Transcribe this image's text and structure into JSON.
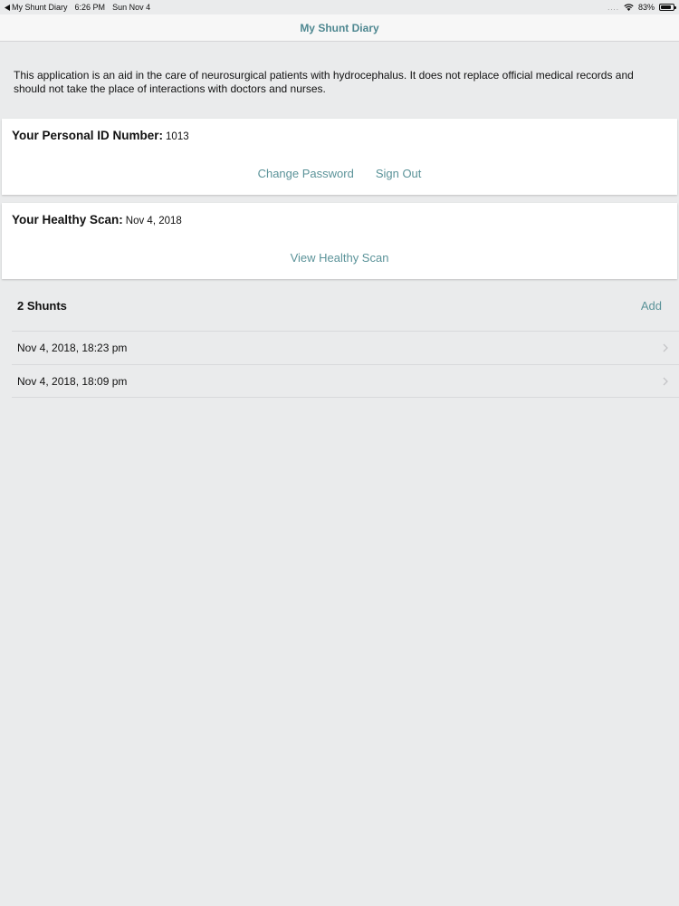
{
  "status_bar": {
    "back_app": "My Shunt Diary",
    "time": "6:26 PM",
    "date": "Sun Nov 4",
    "signal_dots": "....",
    "battery_percent": "83%",
    "battery_level": 0.83
  },
  "nav": {
    "title": "My Shunt Diary"
  },
  "disclaimer": "This application is an aid in the care of neurosurgical patients with hydrocephalus. It does not replace official medical records and should not take the place of interactions with doctors and nurses.",
  "id_card": {
    "label": "Your Personal ID Number:",
    "value": "1013",
    "change_password": "Change Password",
    "sign_out": "Sign Out"
  },
  "scan_card": {
    "label": "Your Healthy Scan:",
    "value": "Nov 4, 2018",
    "view_scan": "View Healthy Scan"
  },
  "shunts": {
    "title": "2 Shunts",
    "add_label": "Add",
    "items": [
      {
        "date": "Nov 4, 2018, 18:23 pm"
      },
      {
        "date": "Nov 4, 2018, 18:09 pm"
      }
    ]
  },
  "colors": {
    "accent": "#5b9399",
    "nav_title": "#4f8891",
    "background": "#eaebec"
  }
}
